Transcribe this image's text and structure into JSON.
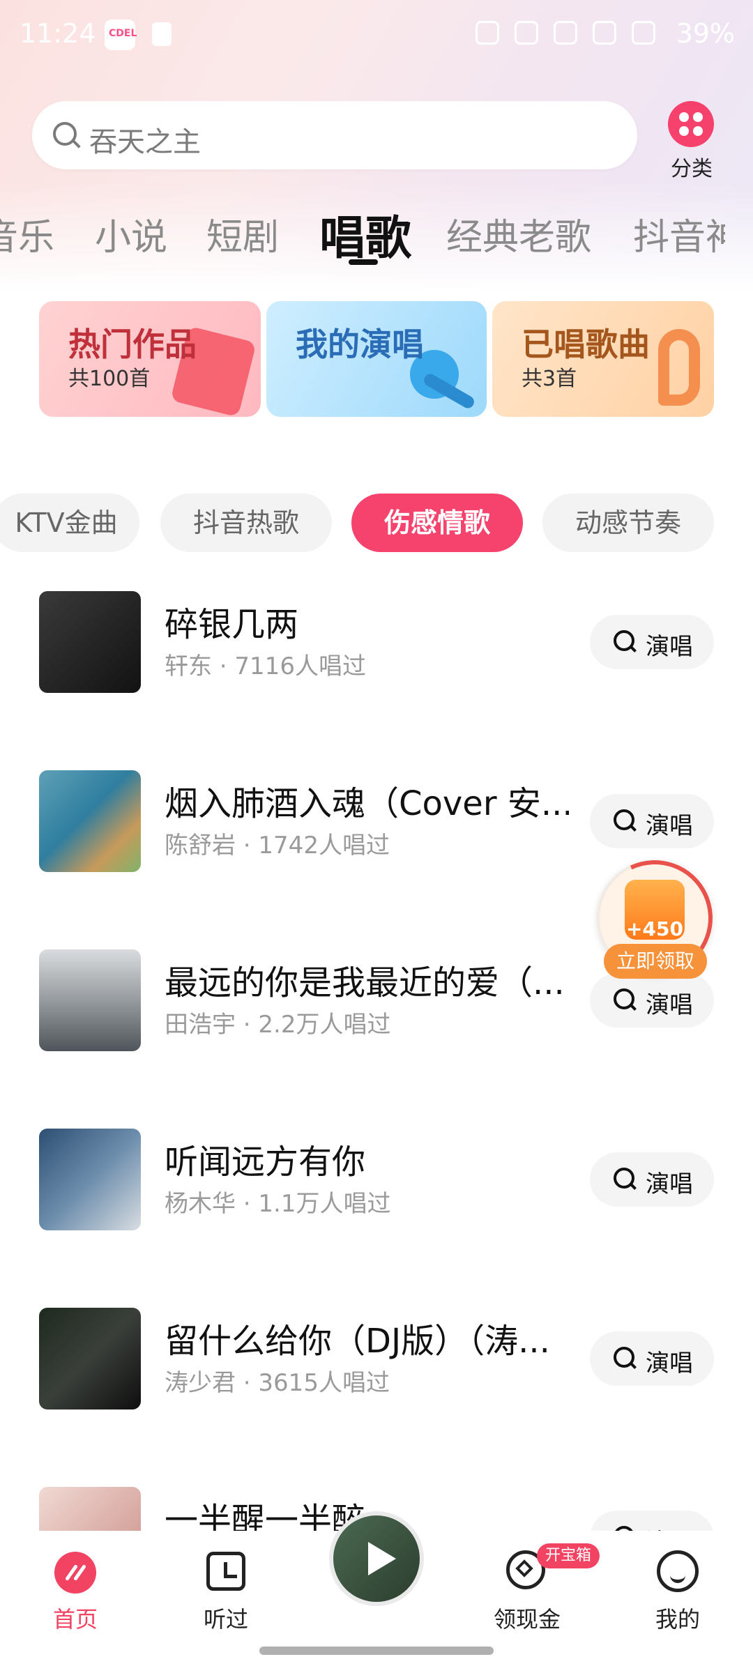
{
  "status_bar": {
    "time": "11:24",
    "app_badge": "CDEL",
    "battery": "39%"
  },
  "search": {
    "placeholder": "吞天之主"
  },
  "category": {
    "label": "分类"
  },
  "tabs": [
    {
      "label": "音乐"
    },
    {
      "label": "小说"
    },
    {
      "label": "短剧"
    },
    {
      "label": "唱歌"
    },
    {
      "label": "经典老歌"
    },
    {
      "label": "抖音神"
    }
  ],
  "features": [
    {
      "title": "热门作品",
      "sub": "共100首"
    },
    {
      "title": "我的演唱",
      "sub": ""
    },
    {
      "title": "已唱歌曲",
      "sub": "共3首"
    }
  ],
  "chips": [
    {
      "label": "KTV金曲"
    },
    {
      "label": "抖音热歌"
    },
    {
      "label": "伤感情歌"
    },
    {
      "label": "动感节奏"
    }
  ],
  "songs": [
    {
      "title": "碎银几两",
      "meta": "轩东 · 7116人唱过"
    },
    {
      "title": "烟入肺酒入魂（Cover 安...",
      "meta": "陈舒岩 · 1742人唱过"
    },
    {
      "title": "最远的你是我最近的爱（...",
      "meta": "田浩宇 · 2.2万人唱过"
    },
    {
      "title": "听闻远方有你",
      "meta": "杨木华 · 1.1万人唱过"
    },
    {
      "title": "留什么给你（DJ版）（涛...",
      "meta": "涛少君 · 3615人唱过"
    },
    {
      "title": "一半醒一半醉",
      "meta": ""
    }
  ],
  "sing_label": "演唱",
  "reward": {
    "amount": "+450",
    "label": "立即领取"
  },
  "bottom_nav": {
    "home": "首页",
    "history": "听过",
    "cash": "领现金",
    "cash_badge": "开宝箱",
    "mine": "我的"
  },
  "colors": {
    "accent": "#f5436d",
    "text": "#111111",
    "muted": "#9a9a9a"
  }
}
